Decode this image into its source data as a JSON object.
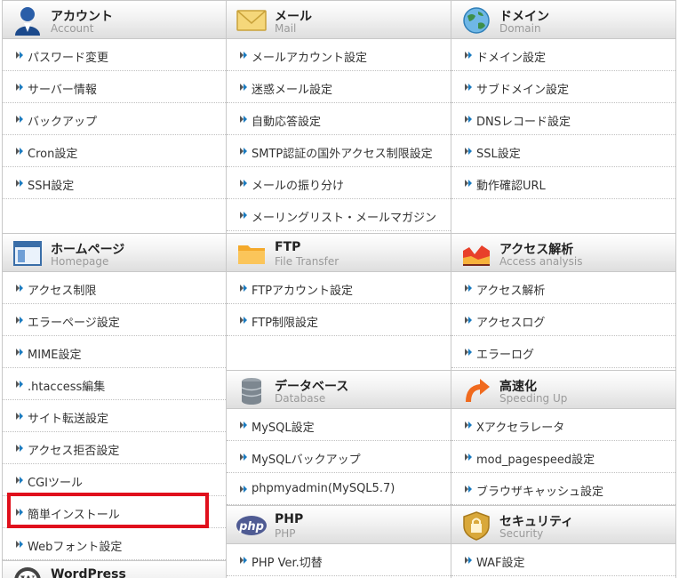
{
  "account": {
    "title": "アカウント",
    "subtitle": "Account",
    "items": [
      "パスワード変更",
      "サーバー情報",
      "バックアップ",
      "Cron設定",
      "SSH設定"
    ]
  },
  "mail": {
    "title": "メール",
    "subtitle": "Mail",
    "items": [
      "メールアカウント設定",
      "迷惑メール設定",
      "自動応答設定",
      "SMTP認証の国外アクセス制限設定",
      "メールの振り分け",
      "メーリングリスト・メールマガジン"
    ]
  },
  "domain": {
    "title": "ドメイン",
    "subtitle": "Domain",
    "items": [
      "ドメイン設定",
      "サブドメイン設定",
      "DNSレコード設定",
      "SSL設定",
      "動作確認URL"
    ]
  },
  "homepage": {
    "title": "ホームページ",
    "subtitle": "Homepage",
    "items": [
      "アクセス制限",
      "エラーページ設定",
      "MIME設定",
      ".htaccess編集",
      "サイト転送設定",
      "アクセス拒否設定",
      "CGIツール",
      "簡単インストール",
      "Webフォント設定"
    ]
  },
  "ftp": {
    "title": "FTP",
    "subtitle": "File Transfer",
    "items": [
      "FTPアカウント設定",
      "FTP制限設定"
    ]
  },
  "analysis": {
    "title": "アクセス解析",
    "subtitle": "Access analysis",
    "items": [
      "アクセス解析",
      "アクセスログ",
      "エラーログ"
    ]
  },
  "database": {
    "title": "データベース",
    "subtitle": "Database",
    "items": [
      "MySQL設定",
      "MySQLバックアップ",
      "phpmyadmin(MySQL5.7)"
    ]
  },
  "speed": {
    "title": "高速化",
    "subtitle": "Speeding Up",
    "items": [
      "Xアクセラレータ",
      "mod_pagespeed設定",
      "ブラウザキャッシュ設定"
    ]
  },
  "php": {
    "title": "PHP",
    "subtitle": "PHP",
    "icon_text": "php",
    "items": [
      "PHP Ver.切替"
    ]
  },
  "security": {
    "title": "セキュリティ",
    "subtitle": "Security",
    "items": [
      "WAF設定"
    ]
  },
  "wordpress": {
    "title": "WordPress"
  },
  "colors": {
    "highlight": "#e0101c",
    "bullet": "#1a7bc0",
    "subtitle": "#9a9a9a"
  }
}
